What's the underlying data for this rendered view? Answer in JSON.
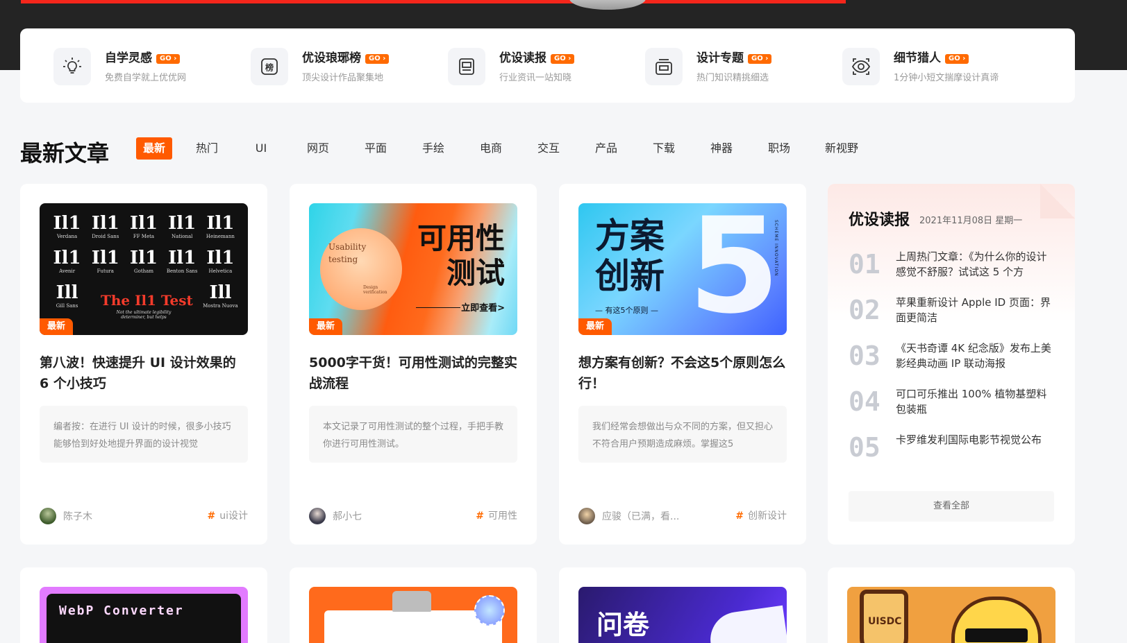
{
  "quick_nav": [
    {
      "title": "自学灵感",
      "go": "GO ›",
      "sub": "免费自学就上优优网",
      "icon": "lightbulb-icon"
    },
    {
      "title": "优设琅琊榜",
      "go": "GO ›",
      "sub": "顶尖设计作品聚集地",
      "icon": "ranking-icon",
      "icon_char": "榜"
    },
    {
      "title": "优设读报",
      "go": "GO ›",
      "sub": "行业资讯一站知晓",
      "icon": "newspaper-icon"
    },
    {
      "title": "设计专题",
      "go": "GO ›",
      "sub": "热门知识精挑细选",
      "icon": "topic-icon"
    },
    {
      "title": "细节猎人",
      "go": "GO ›",
      "sub": "1分钟小短文揣摩设计真谛",
      "icon": "eye-icon"
    }
  ],
  "section": {
    "title": "最新文章",
    "tabs": [
      "最新",
      "热门",
      "UI",
      "网页",
      "平面",
      "手绘",
      "电商",
      "交互",
      "产品",
      "下载",
      "神器",
      "职场",
      "新视野"
    ],
    "active_tab": 0
  },
  "articles": [
    {
      "badge": "最新",
      "title": "第八波！快速提升 UI 设计效果的 6 个小技巧",
      "excerpt": "编者按：在进行 UI 设计的时候，很多小技巧能够恰到好处地提升界面的设计视觉",
      "author": "陈子木",
      "tag": "ui设计",
      "hash": "#",
      "thumb": {
        "fonts": [
          {
            "glyph": "Il1",
            "name": "Verdana"
          },
          {
            "glyph": "Il1",
            "name": "Droid Sans"
          },
          {
            "glyph": "Il1",
            "name": "FF Meta"
          },
          {
            "glyph": "Il1",
            "name": "National"
          },
          {
            "glyph": "Il1",
            "name": "Heinemann"
          },
          {
            "glyph": "Il1",
            "name": "Avenir"
          },
          {
            "glyph": "Il1",
            "name": "Futura"
          },
          {
            "glyph": "Il1",
            "name": "Gotham"
          },
          {
            "glyph": "Il1",
            "name": "Benton Sans"
          },
          {
            "glyph": "Il1",
            "name": "Helvetica"
          },
          {
            "glyph": "Ill",
            "name": "Gill Sans"
          },
          {
            "glyph": "",
            "name": ""
          },
          {
            "glyph": "",
            "name": ""
          },
          {
            "glyph": "",
            "name": ""
          },
          {
            "glyph": "Ill",
            "name": "Mostra Nuova"
          }
        ],
        "headline": "The Il1 Test",
        "subline": "Not the ultimate legibility determiner, but helps"
      }
    },
    {
      "badge": "最新",
      "title": "5000字干货！可用性测试的完整实战流程",
      "excerpt": "本文记录了可用性测试的整个过程，手把手教你进行可用性测试。",
      "author": "郝小七",
      "tag": "可用性",
      "hash": "#",
      "thumb": {
        "usability": "Usability testing",
        "design": "Design verification",
        "headline": "可用性测试",
        "link": "立即查看>"
      }
    },
    {
      "badge": "最新",
      "title": "想方案有创新？不会这5个原则怎么行！",
      "excerpt": "我们经常会想做出与众不同的方案，但又担心不符合用户预期造成麻烦。掌握这5",
      "author": "应骏（已满，看...",
      "tag": "创新设计",
      "hash": "#",
      "thumb": {
        "headline": "方案创新",
        "number": "5",
        "principle": "— 有这5个原则 —",
        "vertical": "SCHEME INNOVATION"
      }
    }
  ],
  "news": {
    "title": "优设读报",
    "date": "2021年11月08日 星期一",
    "items": [
      {
        "num": "01",
        "text": "上周热门文章：《为什么你的设计感觉不舒服？试试这 5 个方"
      },
      {
        "num": "02",
        "text": "苹果重新设计 Apple ID 页面：界面更简洁"
      },
      {
        "num": "03",
        "text": "《天书奇谭 4K 纪念版》发布上美影经典动画 IP 联动海报"
      },
      {
        "num": "04",
        "text": "可口可乐推出 100% 植物基塑料包装瓶"
      },
      {
        "num": "05",
        "text": "卡罗维发利国际电影节视觉公布"
      }
    ],
    "view_all": "查看全部"
  },
  "second_row": [
    {
      "thumb_text": "WebP Converter"
    },
    {
      "thumb_text": ""
    },
    {
      "thumb_text": "问卷"
    },
    {
      "thumb_text": "UISDC"
    }
  ],
  "colors": {
    "accent": "#ff5a00",
    "go_badge": "#ff6a00",
    "header_dark": "#242424",
    "top_red": "#f5261b"
  }
}
